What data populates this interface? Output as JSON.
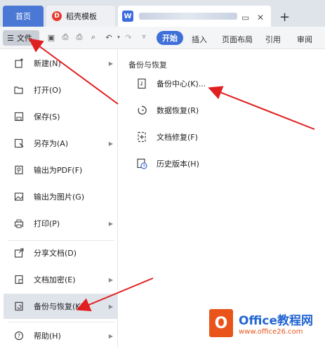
{
  "tabs": {
    "home": "首页",
    "template": "稻壳模板",
    "doc_logo": "W"
  },
  "toolbar": {
    "file_label": "文件",
    "ribbon": [
      "开始",
      "插入",
      "页面布局",
      "引用",
      "审阅"
    ]
  },
  "menu": {
    "items": [
      {
        "label": "新建(N)",
        "icon": "new-icon",
        "submenu": true
      },
      {
        "label": "打开(O)",
        "icon": "folder-open-icon",
        "submenu": false
      },
      {
        "label": "保存(S)",
        "icon": "save-icon",
        "submenu": false
      },
      {
        "label": "另存为(A)",
        "icon": "save-as-icon",
        "submenu": true
      },
      {
        "label": "输出为PDF(F)",
        "icon": "pdf-icon",
        "submenu": false
      },
      {
        "label": "输出为图片(G)",
        "icon": "image-icon",
        "submenu": false
      },
      {
        "label": "打印(P)",
        "icon": "print-icon",
        "submenu": true
      },
      {
        "label": "分享文档(D)",
        "icon": "share-icon",
        "submenu": false
      },
      {
        "label": "文档加密(E)",
        "icon": "lock-icon",
        "submenu": true
      },
      {
        "label": "备份与恢复(K)",
        "icon": "backup-icon",
        "submenu": true
      },
      {
        "label": "帮助(H)",
        "icon": "help-icon",
        "submenu": true
      }
    ]
  },
  "submenu": {
    "title": "备份与恢复",
    "items": [
      {
        "label": "备份中心(K)...",
        "icon": "backup-center-icon"
      },
      {
        "label": "数据恢复(R)",
        "icon": "data-recovery-icon"
      },
      {
        "label": "文档修复(F)",
        "icon": "doc-repair-icon"
      },
      {
        "label": "历史版本(H)",
        "icon": "history-version-icon"
      }
    ]
  },
  "watermark": {
    "logo": "O",
    "brand": "Office教程网",
    "url": "www.office26.com"
  },
  "colors": {
    "accent": "#3f6fd8",
    "arrow": "#e02020",
    "active_bg": "#dfe3ea"
  }
}
